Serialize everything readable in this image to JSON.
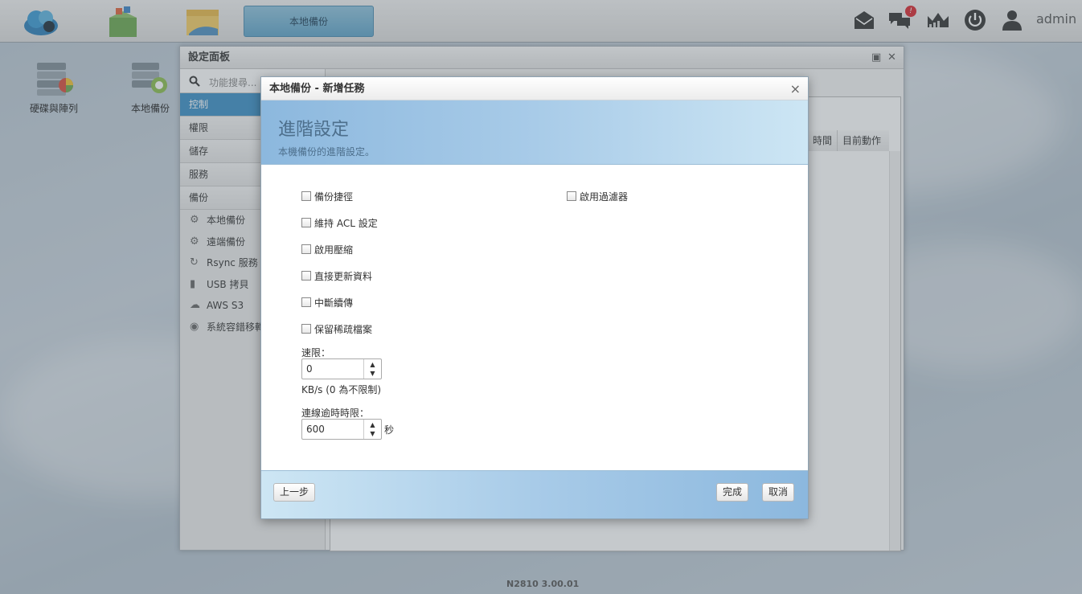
{
  "taskbar": {
    "active_app": "本地備份",
    "notification_count": "!",
    "user": "admin"
  },
  "desktop": {
    "shortcuts": [
      {
        "label": "硬碟與陣列"
      },
      {
        "label": "本地備份"
      }
    ],
    "version": "N2810   3.00.01"
  },
  "panel": {
    "title": "設定面板",
    "search_placeholder": "功能搜尋...",
    "menu": [
      {
        "label": "控制"
      },
      {
        "label": "權限"
      },
      {
        "label": "儲存"
      },
      {
        "label": "服務"
      },
      {
        "label": "備份"
      }
    ],
    "submenu": [
      {
        "label": "本地備份"
      },
      {
        "label": "遠端備份"
      },
      {
        "label": "Rsync 服務"
      },
      {
        "label": "USB 拷貝"
      },
      {
        "label": "AWS S3"
      },
      {
        "label": "系統容錯移轉"
      }
    ],
    "columns": [
      "時間",
      "目前動作"
    ]
  },
  "modal": {
    "title": "本地備份 - 新增任務",
    "heading": "進階設定",
    "subheading": "本機備份的進階設定。",
    "options_left": [
      {
        "label": "備份捷徑",
        "checked": false
      },
      {
        "label": "維持 ACL 設定",
        "checked": false
      },
      {
        "label": "啟用壓縮",
        "checked": false
      },
      {
        "label": "直接更新資料",
        "checked": false
      },
      {
        "label": "中斷續傳",
        "checked": false
      },
      {
        "label": "保留稀疏檔案",
        "checked": false
      }
    ],
    "options_right": [
      {
        "label": "啟用過濾器",
        "checked": false
      }
    ],
    "speed_limit": {
      "label": "速限：",
      "value": "0",
      "hint": "KB/s (0 為不限制)"
    },
    "timeout": {
      "label": "連線逾時時限：",
      "value": "600",
      "unit": "秒"
    },
    "buttons": {
      "back": "上一步",
      "finish": "完成",
      "cancel": "取消"
    }
  },
  "colors": {
    "accent": "#3b8fc6",
    "header_gradient_start": "#8cb8de",
    "header_gradient_end": "#cde6f4",
    "heading_text": "#4d6f8c",
    "badge": "#d9272e"
  }
}
